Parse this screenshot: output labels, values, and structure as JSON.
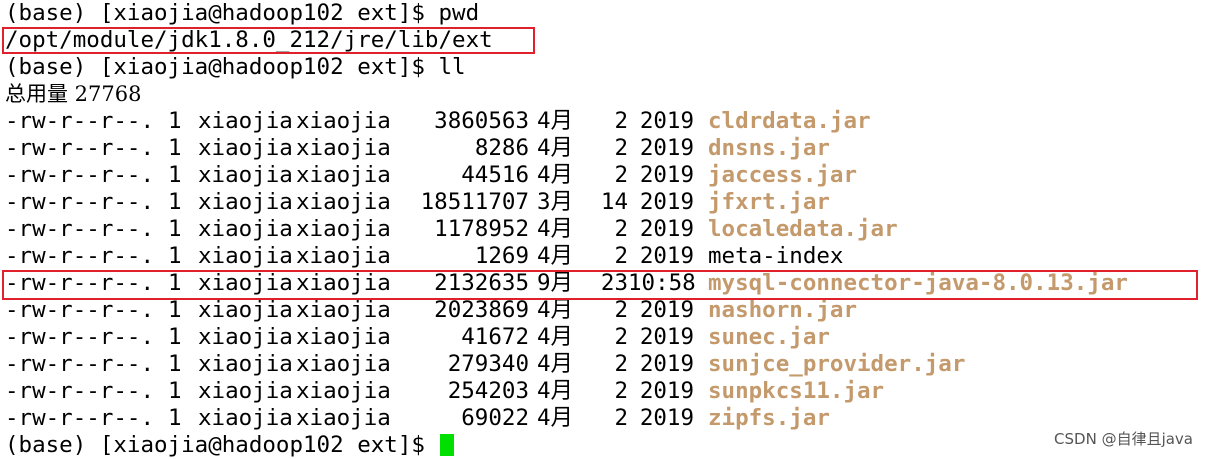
{
  "terminal": {
    "prompt1": "(base) [xiaojia@hadoop102 ext]$ pwd",
    "path_output": "/opt/module/jdk1.8.0_212/jre/lib/ext",
    "prompt2": "(base) [xiaojia@hadoop102 ext]$ ll",
    "total": "总用量 27768",
    "files": [
      {
        "perm": "-rw-r--r--.",
        "links": "1",
        "user": "xiaojia",
        "group": "xiaojia",
        "size": "3860563",
        "month": "4月",
        "day": "2",
        "time": "2019",
        "name": "cldrdata.jar",
        "type": "jar"
      },
      {
        "perm": "-rw-r--r--.",
        "links": "1",
        "user": "xiaojia",
        "group": "xiaojia",
        "size": "8286",
        "month": "4月",
        "day": "2",
        "time": "2019",
        "name": "dnsns.jar",
        "type": "jar"
      },
      {
        "perm": "-rw-r--r--.",
        "links": "1",
        "user": "xiaojia",
        "group": "xiaojia",
        "size": "44516",
        "month": "4月",
        "day": "2",
        "time": "2019",
        "name": "jaccess.jar",
        "type": "jar"
      },
      {
        "perm": "-rw-r--r--.",
        "links": "1",
        "user": "xiaojia",
        "group": "xiaojia",
        "size": "18511707",
        "month": "3月",
        "day": "14",
        "time": "2019",
        "name": "jfxrt.jar",
        "type": "jar"
      },
      {
        "perm": "-rw-r--r--.",
        "links": "1",
        "user": "xiaojia",
        "group": "xiaojia",
        "size": "1178952",
        "month": "4月",
        "day": "2",
        "time": "2019",
        "name": "localedata.jar",
        "type": "jar"
      },
      {
        "perm": "-rw-r--r--.",
        "links": "1",
        "user": "xiaojia",
        "group": "xiaojia",
        "size": "1269",
        "month": "4月",
        "day": "2",
        "time": "2019",
        "name": "meta-index",
        "type": "plain"
      },
      {
        "perm": "-rw-r--r--.",
        "links": "1",
        "user": "xiaojia",
        "group": "xiaojia",
        "size": "2132635",
        "month": "9月",
        "day": "23",
        "time": "10:58",
        "name": "mysql-connector-java-8.0.13.jar",
        "type": "jar"
      },
      {
        "perm": "-rw-r--r--.",
        "links": "1",
        "user": "xiaojia",
        "group": "xiaojia",
        "size": "2023869",
        "month": "4月",
        "day": "2",
        "time": "2019",
        "name": "nashorn.jar",
        "type": "jar"
      },
      {
        "perm": "-rw-r--r--.",
        "links": "1",
        "user": "xiaojia",
        "group": "xiaojia",
        "size": "41672",
        "month": "4月",
        "day": "2",
        "time": "2019",
        "name": "sunec.jar",
        "type": "jar"
      },
      {
        "perm": "-rw-r--r--.",
        "links": "1",
        "user": "xiaojia",
        "group": "xiaojia",
        "size": "279340",
        "month": "4月",
        "day": "2",
        "time": "2019",
        "name": "sunjce_provider.jar",
        "type": "jar"
      },
      {
        "perm": "-rw-r--r--.",
        "links": "1",
        "user": "xiaojia",
        "group": "xiaojia",
        "size": "254203",
        "month": "4月",
        "day": "2",
        "time": "2019",
        "name": "sunpkcs11.jar",
        "type": "jar"
      },
      {
        "perm": "-rw-r--r--.",
        "links": "1",
        "user": "xiaojia",
        "group": "xiaojia",
        "size": "69022",
        "month": "4月",
        "day": "2",
        "time": "2019",
        "name": "zipfs.jar",
        "type": "jar"
      }
    ],
    "prompt3": "(base) [xiaojia@hadoop102 ext]$ "
  },
  "watermark": "CSDN @自律且java",
  "colors": {
    "background": "#ffffff",
    "text": "#000000",
    "jar_file": "#c49a6c",
    "highlight_box": "#e0202a",
    "cursor": "#00e000"
  }
}
